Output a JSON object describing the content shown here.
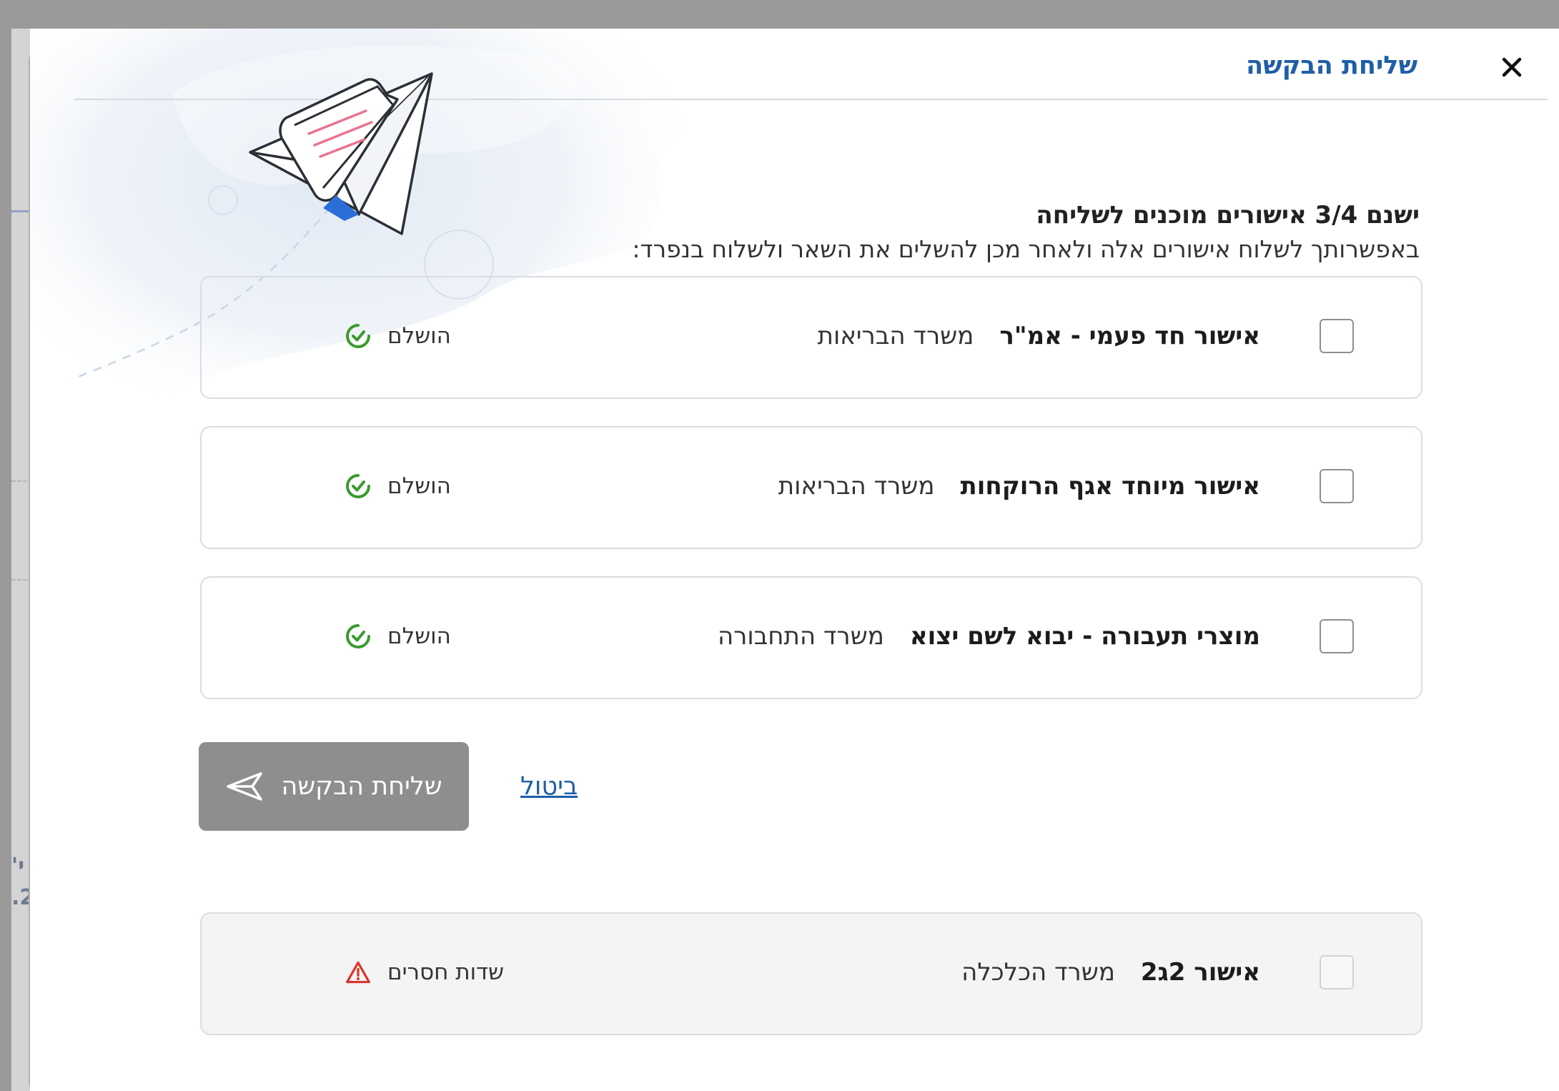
{
  "dialog": {
    "title": "שליחת הבקשה",
    "close_label": "×"
  },
  "intro": {
    "title": "ישנם 3/4 אישורים מוכנים לשליחה",
    "subtitle": "באפשרותך לשלוח אישורים אלה ולאחר מכן להשלים את השאר ולשלוח בנפרד:"
  },
  "approvals": [
    {
      "name": "אישור חד פעמי - אמ\"ר",
      "org": "משרד הבריאות",
      "status": "הושלם",
      "status_type": "complete",
      "checked": false
    },
    {
      "name": "אישור מיוחד אגף הרוקחות",
      "org": "משרד הבריאות",
      "status": "הושלם",
      "status_type": "complete",
      "checked": false
    },
    {
      "name": "מוצרי תעבורה - יבוא לשם יצוא",
      "org": "משרד התחבורה",
      "status": "הושלם",
      "status_type": "complete",
      "checked": false
    }
  ],
  "actions": {
    "send_label": "שליחת הבקשה",
    "cancel_label": "ביטול"
  },
  "incomplete": [
    {
      "name": "אישור 2ג2",
      "org": "משרד הכלכלה",
      "status": "שדות חסרים",
      "status_type": "missing",
      "checked": false
    }
  ],
  "background": {
    "side_text_line1": "'י",
    "side_text_line2": ".2"
  },
  "colors": {
    "accent": "#1f5fa7",
    "success": "#3a9a2e",
    "warning": "#d9342b",
    "disabled_button": "#8e8e8e",
    "card_border": "#d9dde3"
  },
  "icons": {
    "close": "close-icon",
    "complete": "check-circle-icon",
    "missing": "warning-triangle-icon",
    "send": "paper-plane-icon",
    "illustration": "paper-plane-illustration"
  }
}
